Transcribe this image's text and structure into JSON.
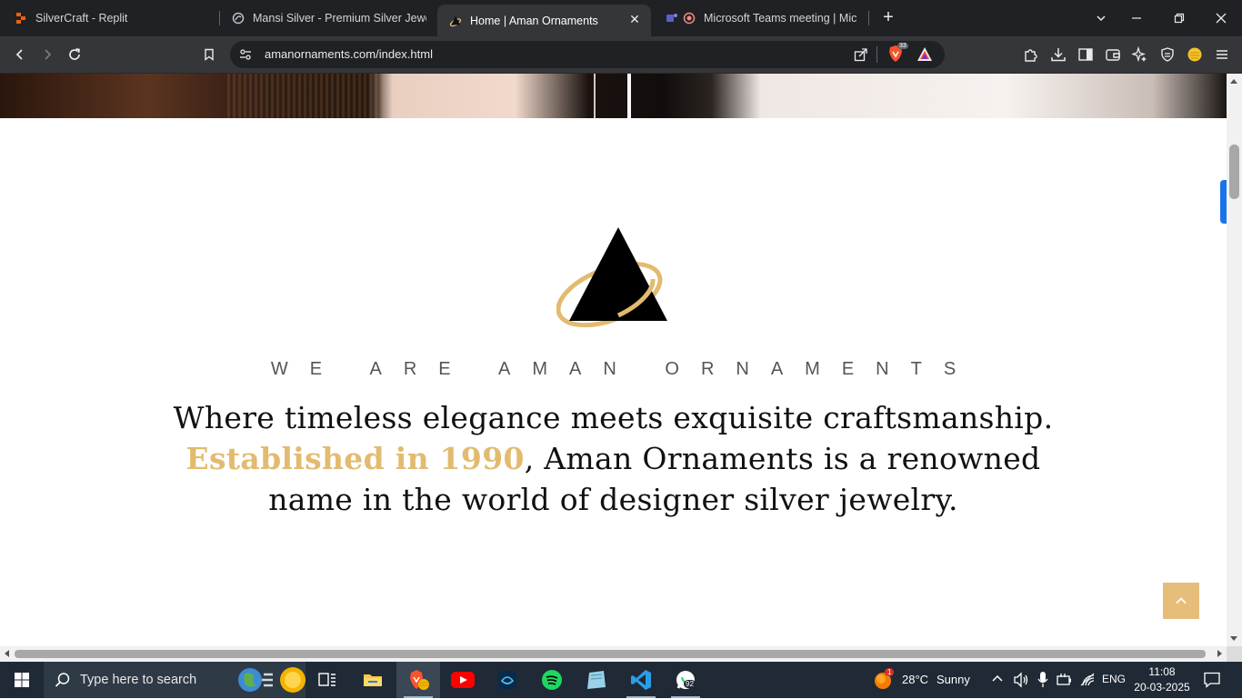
{
  "browser": {
    "tabs": [
      {
        "title": "SilverCraft - Replit",
        "icon": "replit-icon",
        "active": false
      },
      {
        "title": "Mansi Silver - Premium Silver Jewelr",
        "icon": "globe-icon",
        "active": false
      },
      {
        "title": "Home | Aman Ornaments",
        "icon": "aman-logo-icon",
        "active": true
      },
      {
        "title": "Microsoft Teams meeting | Micro",
        "icon": "teams-icon",
        "active": false
      }
    ],
    "url": "amanornaments.com/index.html",
    "shields_count": "33"
  },
  "page": {
    "tagline": "WE ARE AMAN ORNAMENTS",
    "intro_line1": "Where timeless elegance meets exquisite craftsmanship.",
    "intro_highlight": "Established in 1990",
    "intro_line2_rest": ", Aman Ornaments is a renowned",
    "intro_line3": "name in the world of designer silver jewelry.",
    "accent_color": "#e2bb70"
  },
  "taskbar": {
    "search_placeholder": "Type here to search",
    "weather_temp": "28°C",
    "weather_desc": "Sunny",
    "weather_badge": "1",
    "language": "ENG",
    "time": "11:08",
    "date": "20-03-2025",
    "chat_badge": "92"
  }
}
